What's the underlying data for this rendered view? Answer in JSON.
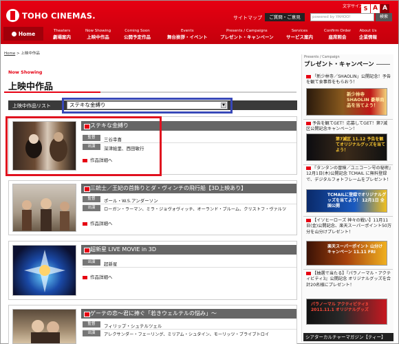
{
  "header": {
    "logo_text": "TOHO CINEMAS.",
    "font_size_label": "文字サイズ：",
    "font_sizes": [
      "S",
      "A",
      "A"
    ],
    "sitemap": "サイトマップ",
    "ask_button": "ご質問・ご意見",
    "search_brand": "powered by YAHOO!",
    "search_button": "検索"
  },
  "nav": [
    {
      "en": "Home",
      "jp": ""
    },
    {
      "en": "Theaters",
      "jp": "劇場案内"
    },
    {
      "en": "Now Showing",
      "jp": "上映中作品"
    },
    {
      "en": "Coming Soon",
      "jp": "公開予定作品"
    },
    {
      "en": "Events",
      "jp": "舞台挨拶・イベント"
    },
    {
      "en": "Presents / Campaigns",
      "jp": "プレゼント・キャンペーン"
    },
    {
      "en": "Services",
      "jp": "サービス案内"
    },
    {
      "en": "Confirm Order",
      "jp": "座席照会"
    },
    {
      "en": "About Us",
      "jp": "企業情報"
    }
  ],
  "breadcrumb": {
    "home": "Home",
    "current": "上映中作品"
  },
  "main": {
    "eyebrow": "Now Showing",
    "title": "上映中作品",
    "list_label": "上映中作品リスト",
    "select_value": "ステキな金縛り"
  },
  "movies": [
    {
      "title": "ステキな金縛り",
      "director": "三谷幸喜",
      "cast": "深津絵里、西田敏行",
      "detail": "作品詳細へ"
    },
    {
      "title": "三銃士／王妃の首飾りとダ・ヴィンチの飛行船【3D上映あり】",
      "director": "ポール・W.S.アンダーソン",
      "cast": "ローガン・ラーマン、ミラ・ジョヴォヴィッチ、オーランド・ブルーム、クリストフ・ヴァルツ",
      "detail": "作品詳細へ"
    },
    {
      "title": "超新星 LIVE MOVIE in 3D",
      "director": "",
      "cast": "超新星",
      "detail": "作品詳細へ"
    },
    {
      "title": "ゲーテの恋～君に捧ぐ「若きウェルテルの悩み」～",
      "director": "フィリップ・シュテルツェル",
      "cast": "アレクサンダー・フェーリング、ミリアム・シュタイン、モーリッツ・ブライブトロイ",
      "detail": "作品詳細へ"
    }
  ],
  "roles": {
    "director": "監督",
    "cast": "出演"
  },
  "sidebar": {
    "eyebrow": "Presents / Campaign",
    "title": "プレゼント・キャンペーン",
    "items": [
      "「新少林寺／SHAOLIN」公開記念！予告を観て食事券をもらおう！",
      "予告を観てGET！応募してGET！第7滅区公開記念キャンペーン！",
      "『タンタンの冒険／ユニコーン号の秘密』12月1日(木)公開記念 TCMAIL に無料登録で、デジタルフォトフレームをプレゼント！",
      "【イソヒーローズ 神々の戦い】11月11日(金)公開記念、楽天スーパーポイント50万分を山分けプレゼント！",
      "【抽選で当たる】『パラノーマル・アクティビティ3』公開記念 オリジナルグッズを合計20名様にプレゼント！"
    ],
    "banners": [
      "新少林寺 SHAOLIN 豪華商品を当てよう！",
      "第7滅区 11.12 予告を観てオリジナルグッズを当てよう！",
      "TCMAILに登録でオリジナルグッズを当てよう！ 12月1日 全国公開",
      "楽天スーパーポイント 山分けキャンペーン 11.11 FRI",
      "パラノーマル アクティビティ3 2011.11.1 オリジナルグッズ"
    ],
    "magazine": "シアターカルチャーマガジン【ティー】"
  }
}
